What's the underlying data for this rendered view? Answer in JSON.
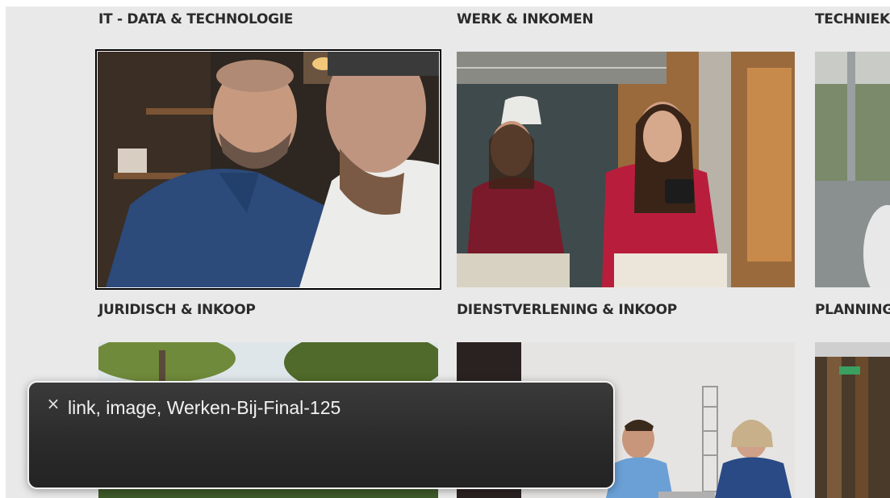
{
  "categories": [
    {
      "title": "IT - DATA & TECHNOLOGIE",
      "image_alt": "Werken-Bij-Final-125"
    },
    {
      "title": "WERK & INKOMEN",
      "image_alt": ""
    },
    {
      "title": "TECHNIEK",
      "image_alt": ""
    },
    {
      "title": "JURIDISCH & INKOOP",
      "image_alt": ""
    },
    {
      "title": "DIENSTVERLENING & INKOOP",
      "image_alt": ""
    },
    {
      "title": "PLANNING",
      "image_alt": ""
    }
  ],
  "voiceover": {
    "close_symbol": "×",
    "text": "link, image, Werken-Bij-Final-125"
  },
  "icons": {
    "close": "close-icon"
  },
  "colors": {
    "page_background": "#e9e9e9",
    "heading_text": "#2b2b2b",
    "panel_background": "#2a2a2a",
    "panel_border": "#f3f3f3"
  }
}
